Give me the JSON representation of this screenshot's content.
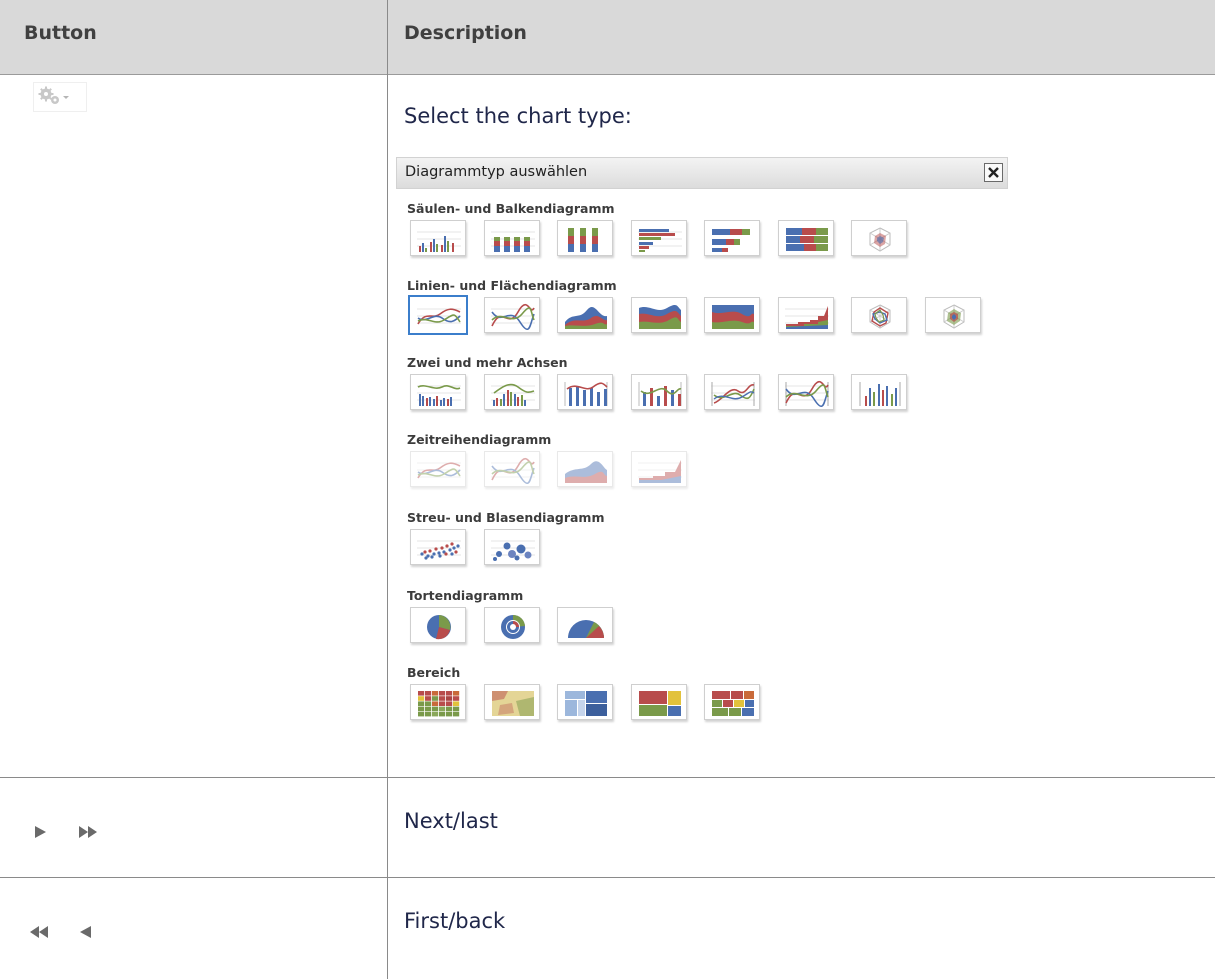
{
  "table": {
    "header_button": "Button",
    "header_description": "Description"
  },
  "rows": {
    "chart_type": {
      "text": "Select the chart type:",
      "button_icon": "gear-dropdown-icon"
    },
    "next_last": {
      "text": "Next/last",
      "icons": [
        "next-icon",
        "last-icon"
      ]
    },
    "first_back": {
      "text": "First/back",
      "icons": [
        "first-icon",
        "back-icon"
      ]
    }
  },
  "dialog": {
    "title": "Diagrammtyp auswählen",
    "close_icon": "close-icon",
    "selected_type": "line-smooth",
    "sections": [
      {
        "label": "Säulen- und Balkendiagramm",
        "items": [
          "column-clustered",
          "column-stacked",
          "column-stacked-100",
          "bar-clustered",
          "bar-stacked",
          "bar-stacked-100",
          "radar-column"
        ]
      },
      {
        "label": "Linien- und Flächendiagramm",
        "items": [
          "line-smooth",
          "line-curved",
          "area",
          "area-stacked",
          "area-stacked-100",
          "area-step",
          "radar-line",
          "radar-area"
        ]
      },
      {
        "label": "Zwei und mehr Achsen",
        "items": [
          "column-line-dual",
          "column-line-dual-2",
          "column-line-multi",
          "column-line-multi-2",
          "line-dual-axis",
          "line-multi-axis",
          "column-multi-axis"
        ]
      },
      {
        "label": "Zeitreihendiagramm",
        "items": [
          "timeseries-line",
          "timeseries-curved",
          "timeseries-area",
          "timeseries-step"
        ],
        "disabled": true
      },
      {
        "label": "Streu- und Blasendiagramm",
        "items": [
          "scatter",
          "bubble"
        ]
      },
      {
        "label": "Tortendiagramm",
        "items": [
          "pie",
          "donut",
          "half-pie"
        ]
      },
      {
        "label": "Bereich",
        "items": [
          "heatmap",
          "heatmap-geo",
          "treemap",
          "treemap-2",
          "treemap-3"
        ]
      }
    ]
  },
  "colors": {
    "red": "#b84c4c",
    "blue": "#4a6fb0",
    "green": "#7a9a4a",
    "yellow": "#e2c23c",
    "selected_border": "#3b7ecb"
  }
}
